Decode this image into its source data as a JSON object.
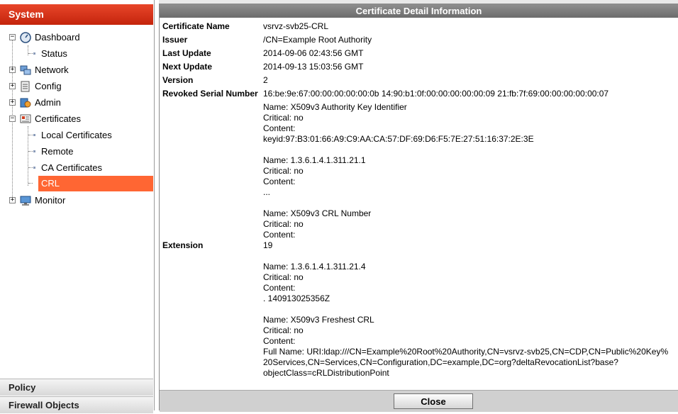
{
  "sidebar": {
    "header": "System",
    "items": [
      {
        "label": "Dashboard"
      },
      {
        "label": "Status"
      },
      {
        "label": "Network"
      },
      {
        "label": "Config"
      },
      {
        "label": "Admin"
      },
      {
        "label": "Certificates"
      },
      {
        "label": "Local Certificates"
      },
      {
        "label": "Remote"
      },
      {
        "label": "CA Certificates"
      },
      {
        "label": "CRL"
      },
      {
        "label": "Monitor"
      }
    ],
    "accordion": [
      "Policy",
      "Firewall Objects"
    ]
  },
  "detail": {
    "title": "Certificate Detail Information",
    "fields": [
      {
        "key": "Certificate Name",
        "value": "vsrvz-svb25-CRL"
      },
      {
        "key": "Issuer",
        "value": "/CN=Example Root Authority"
      },
      {
        "key": "Last Update",
        "value": "2014-09-06 02:43:56 GMT"
      },
      {
        "key": "Next Update",
        "value": "2014-09-13 15:03:56 GMT"
      },
      {
        "key": "Version",
        "value": "2"
      },
      {
        "key": "Revoked Serial Number",
        "value": "16:be:9e:67:00:00:00:00:00:0b 14:90:b1:0f:00:00:00:00:00:09 21:fb:7f:69:00:00:00:00:00:07"
      }
    ],
    "extension_key": "Extension",
    "extension_lines": [
      "Name: X509v3 Authority Key Identifier",
      "Critical: no",
      "Content:",
      "keyid:97:B3:01:66:A9:C9:AA:CA:57:DF:69:D6:F5:7E:27:51:16:37:2E:3E",
      "",
      "Name: 1.3.6.1.4.1.311.21.1",
      "Critical: no",
      "Content:",
      "...",
      "",
      "Name: X509v3 CRL Number",
      "Critical: no",
      "Content:",
      "19",
      "",
      "Name: 1.3.6.1.4.1.311.21.4",
      "Critical: no",
      "Content:",
      ". 140913025356Z",
      "",
      "Name: X509v3 Freshest CRL",
      "Critical: no",
      "Content:",
      "Full Name: URI:ldap:///CN=Example%20Root%20Authority,CN=vsrvz-svb25,CN=CDP,CN=Public%20Key%",
      "20Services,CN=Services,CN=Configuration,DC=example,DC=org?deltaRevocationList?base?",
      "objectClass=cRLDistributionPoint"
    ],
    "close_label": "Close"
  }
}
